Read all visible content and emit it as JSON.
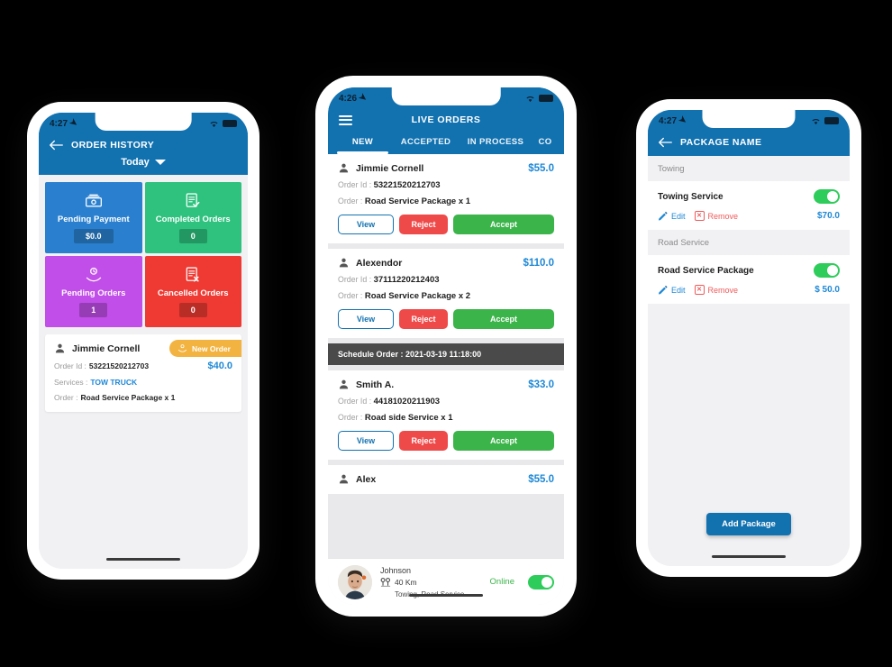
{
  "colors": {
    "brand_blue": "#1272b0",
    "link_blue": "#1e88d6",
    "accept_green": "#3bb44a",
    "reject_red": "#ef4a4a",
    "badge_amber": "#f3b340",
    "tile_blue": "#2a80cf",
    "tile_green": "#2ec27e",
    "tile_purple": "#c14ee8",
    "tile_red": "#ee3a33",
    "schedule_gray": "#4a4a4a",
    "canvas": "#000000"
  },
  "phone1": {
    "status": {
      "time": "4:27",
      "location_icon": "location-arrow-icon",
      "wifi_icon": "wifi-icon",
      "battery_icon": "battery-icon"
    },
    "appbar": {
      "back_icon": "back-arrow-icon",
      "title": "ORDER HISTORY"
    },
    "filter": {
      "label": "Today",
      "caret_icon": "chevron-down-icon"
    },
    "tiles": [
      {
        "label": "Pending Payment",
        "value": "$0.0",
        "icon": "cash-payment-icon",
        "color": "#2a80cf"
      },
      {
        "label": "Completed Orders",
        "value": "0",
        "icon": "document-check-icon",
        "color": "#2ec27e"
      },
      {
        "label": "Pending Orders",
        "value": "1",
        "icon": "hand-clock-icon",
        "color": "#c14ee8"
      },
      {
        "label": "Cancelled Orders",
        "value": "0",
        "icon": "document-x-icon",
        "color": "#ee3a33"
      }
    ],
    "order_card": {
      "avatar_icon": "person-icon",
      "name": "Jimmie Cornell",
      "badge": {
        "label": "New Order",
        "icon": "hand-service-icon"
      },
      "order_id_key": "Order Id :",
      "order_id_value": "53221520212703",
      "amount": "$40.0",
      "services_key": "Services :",
      "services_value": "TOW TRUCK",
      "order_key": "Order :",
      "order_value": "Road Service Package x 1"
    }
  },
  "phone2": {
    "status": {
      "time": "4:26",
      "location_icon": "location-arrow-icon",
      "wifi_icon": "wifi-icon",
      "battery_icon": "battery-icon"
    },
    "appbar": {
      "menu_icon": "hamburger-menu-icon",
      "title": "LIVE ORDERS"
    },
    "tabs": [
      {
        "label": "NEW",
        "active": true
      },
      {
        "label": "ACCEPTED",
        "active": false
      },
      {
        "label": "IN PROCESS",
        "active": false
      },
      {
        "label": "CO",
        "active": false
      }
    ],
    "buttons": {
      "view": "View",
      "reject": "Reject",
      "accept": "Accept"
    },
    "labels": {
      "order_id_key": "Order Id :",
      "order_key": "Order :"
    },
    "orders": [
      {
        "avatar_icon": "person-icon",
        "name": "Jimmie Cornell",
        "amount": "$55.0",
        "order_id": "53221520212703",
        "order": "Road Service Package x 1"
      },
      {
        "avatar_icon": "person-icon",
        "name": "Alexendor",
        "amount": "$110.0",
        "order_id": "37111220212403",
        "order": "Road Service Package x 2"
      }
    ],
    "schedule_bar": "Schedule Order : 2021-03-19 11:18:00",
    "scheduled_orders": [
      {
        "avatar_icon": "person-icon",
        "name": "Smith A.",
        "amount": "$33.0",
        "order_id": "44181020211903",
        "order": "Road side Service x 1"
      }
    ],
    "partial_order": {
      "avatar_icon": "person-icon",
      "name": "Alex",
      "amount": "$55.0"
    },
    "bottom_bar": {
      "avatar_icon": "driver-photo",
      "name": "Johnson",
      "distance_icon": "location-pin-icon",
      "distance": "40 Km",
      "services": "Towing, Road Service",
      "status_label": "Online",
      "toggle": "on"
    }
  },
  "phone3": {
    "status": {
      "time": "4:27",
      "location_icon": "location-arrow-icon",
      "wifi_icon": "wifi-icon",
      "battery_icon": "battery-icon"
    },
    "appbar": {
      "back_icon": "back-arrow-icon",
      "title": "PACKAGE NAME"
    },
    "actions": {
      "edit": "Edit",
      "remove": "Remove",
      "edit_icon": "pencil-icon",
      "remove_icon": "x-box-icon"
    },
    "sections": [
      {
        "heading": "Towing",
        "package": {
          "name": "Towing Service",
          "price": "$70.0",
          "toggle": "on"
        }
      },
      {
        "heading": "Road Service",
        "package": {
          "name": "Road Service Package",
          "price": "$ 50.0",
          "toggle": "on"
        }
      }
    ],
    "add_button": "Add Package"
  }
}
